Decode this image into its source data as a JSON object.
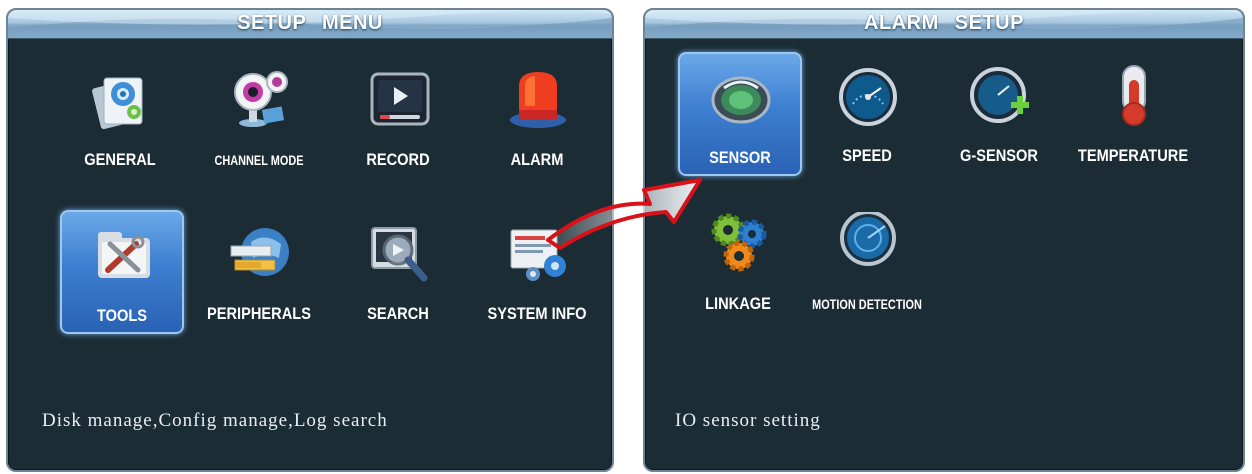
{
  "setup_menu": {
    "title": "SETUP  MENU",
    "items": [
      {
        "label": "GENERAL",
        "icon": "general-icon"
      },
      {
        "label": "CHANNEL MODE",
        "icon": "webcam-icon"
      },
      {
        "label": "RECORD",
        "icon": "record-icon"
      },
      {
        "label": "ALARM",
        "icon": "alarm-light-icon"
      },
      {
        "label": "TOOLS",
        "icon": "tools-icon",
        "selected": true
      },
      {
        "label": "PERIPHERALS",
        "icon": "peripherals-icon"
      },
      {
        "label": "SEARCH",
        "icon": "search-icon"
      },
      {
        "label": "SYSTEM INFO",
        "icon": "system-info-icon"
      }
    ],
    "status_text": "Disk manage,Config manage,Log search"
  },
  "alarm_setup": {
    "title": "ALARM  SETUP",
    "items": [
      {
        "label": "SENSOR",
        "icon": "sensor-icon",
        "selected": true
      },
      {
        "label": "SPEED",
        "icon": "speedometer-icon"
      },
      {
        "label": "G-SENSOR",
        "icon": "g-sensor-icon"
      },
      {
        "label": "TEMPERATURE",
        "icon": "thermometer-icon"
      },
      {
        "label": "LINKAGE",
        "icon": "gears-icon"
      },
      {
        "label": "MOTION DETECTION",
        "icon": "motion-detection-icon"
      }
    ],
    "status_text": "IO sensor setting"
  },
  "colors": {
    "panel_bg": "#1b2c34",
    "selection": "#3d7fd0",
    "arrow": "#d9121a"
  }
}
